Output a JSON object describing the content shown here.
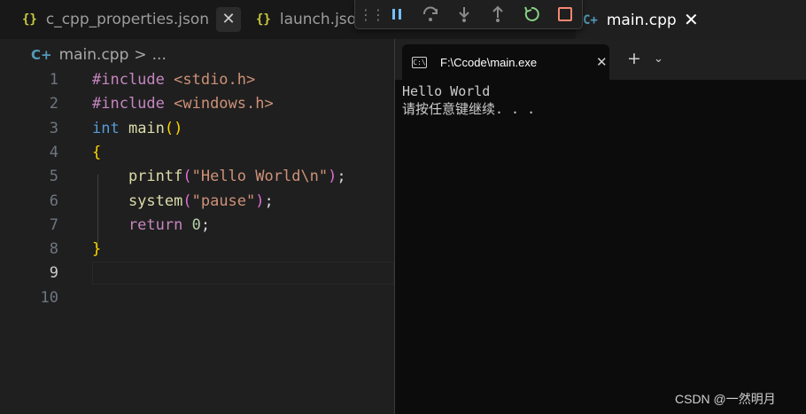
{
  "tabs": [
    {
      "icon": "{}",
      "label": "c_cpp_properties.json"
    },
    {
      "icon": "{}",
      "label": "launch.json"
    },
    {
      "icon": "C+",
      "label": "main.cpp"
    }
  ],
  "debug_toolbar": {
    "buttons": [
      "grip-icon",
      "pause-icon",
      "step-over-icon",
      "step-into-icon",
      "step-out-icon",
      "restart-icon",
      "stop-icon"
    ],
    "colors": {
      "pause": "#75beff",
      "restart": "#89d185",
      "stop": "#f48771",
      "disabled": "#8b8b8b"
    }
  },
  "breadcrumb": {
    "file": "main.cpp",
    "separator": ">",
    "more": "..."
  },
  "editor": {
    "line_numbers": [
      "1",
      "2",
      "3",
      "4",
      "5",
      "6",
      "7",
      "8",
      "9",
      "10"
    ],
    "active_line": "9",
    "lines": [
      [
        {
          "t": "#include ",
          "c": "kw"
        },
        {
          "t": "<stdio.h>",
          "c": "str"
        }
      ],
      [
        {
          "t": "#include ",
          "c": "kw"
        },
        {
          "t": "<windows.h>",
          "c": "str"
        }
      ],
      [
        {
          "t": "int ",
          "c": "type"
        },
        {
          "t": "main",
          "c": "fn"
        },
        {
          "t": "()",
          "c": "br1"
        }
      ],
      [
        {
          "t": "{",
          "c": "br1"
        }
      ],
      [
        {
          "t": "    printf",
          "c": "fn"
        },
        {
          "t": "(",
          "c": "br2"
        },
        {
          "t": "\"Hello World\\n\"",
          "c": "str"
        },
        {
          "t": ")",
          "c": "br2"
        },
        {
          "t": ";",
          "c": "plain"
        }
      ],
      [
        {
          "t": "    system",
          "c": "fn"
        },
        {
          "t": "(",
          "c": "br2"
        },
        {
          "t": "\"pause\"",
          "c": "str"
        },
        {
          "t": ")",
          "c": "br2"
        },
        {
          "t": ";",
          "c": "plain"
        }
      ],
      [
        {
          "t": "    return ",
          "c": "kw"
        },
        {
          "t": "0",
          "c": "num"
        },
        {
          "t": ";",
          "c": "plain"
        }
      ],
      [
        {
          "t": "}",
          "c": "br1"
        }
      ],
      [],
      []
    ]
  },
  "terminal": {
    "icon": "C:\\",
    "title": "F:\\Ccode\\main.exe",
    "close": "✕",
    "add": "+",
    "dropdown": "⌄",
    "output": [
      "Hello World",
      "请按任意键继续. . ."
    ]
  },
  "watermark": "CSDN @一然明月"
}
